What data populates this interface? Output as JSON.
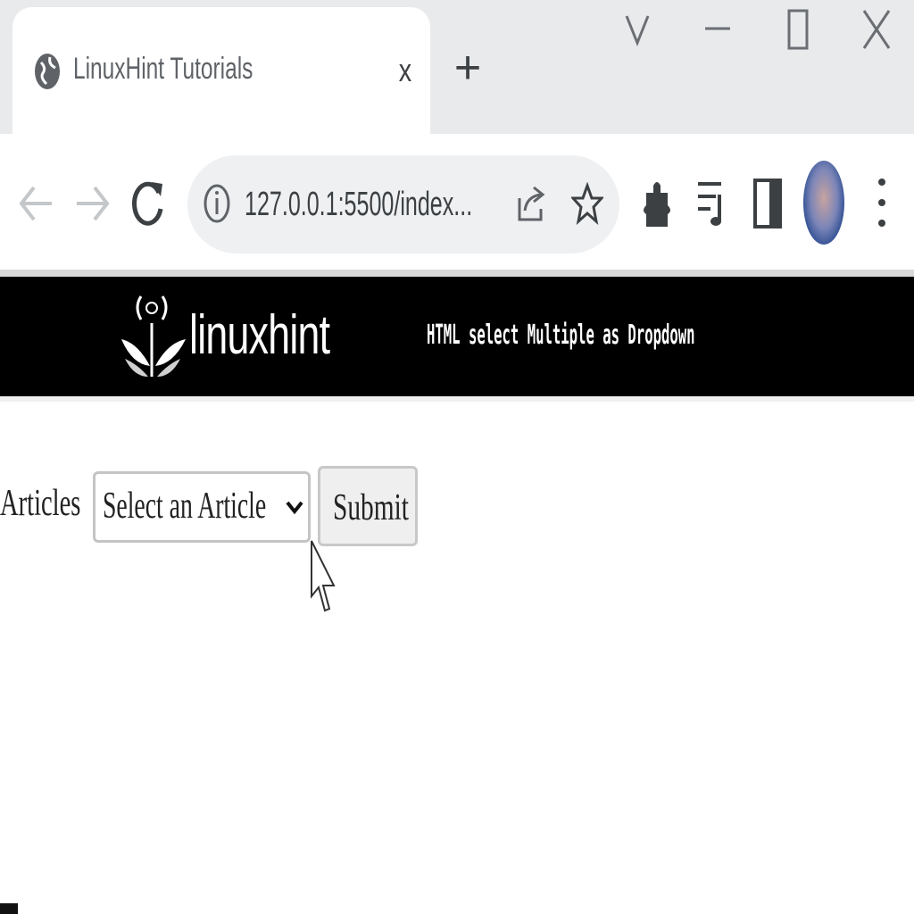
{
  "browser": {
    "tab": {
      "title": "LinuxHint Tutorials",
      "favicon": "globe-icon",
      "close": "x"
    },
    "new_tab": "+",
    "window_controls": [
      "chevron-down-icon",
      "minimize-icon",
      "maximize-icon",
      "close-icon"
    ],
    "address_bar": {
      "url": "127.0.0.1:5500/index...",
      "info_icon": "info-icon"
    },
    "toolbar_icons": [
      "back-arrow-icon",
      "forward-arrow-icon",
      "reload-icon",
      "share-icon",
      "star-icon",
      "extensions-icon",
      "media-icon",
      "side-panel-icon",
      "profile-avatar",
      "more-menu-icon"
    ]
  },
  "page": {
    "header": {
      "logo_text": "linuxhint",
      "title": "HTML select Multiple as Dropdown"
    },
    "form": {
      "label": "Articles",
      "select_value": "Select an Article",
      "submit_label": "Submit"
    }
  },
  "colors": {
    "header_bg": "#000000",
    "tab_strip_bg": "#e9eaec",
    "omnibox_bg": "#eef0f2",
    "button_bg": "#efefef"
  }
}
